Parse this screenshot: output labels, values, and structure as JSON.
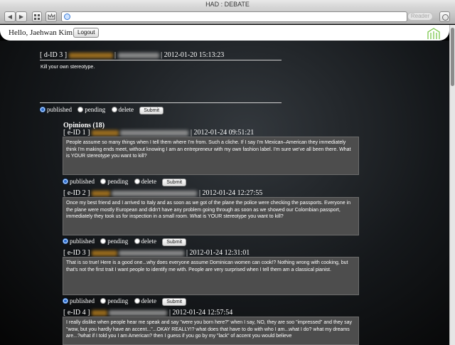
{
  "window": {
    "title": "HAD : DEBATE"
  },
  "toolbar": {
    "back_label": "◀",
    "forward_label": "▶",
    "reader_label": "Reader"
  },
  "header": {
    "greeting": "Hello, Jaehwan Kim. |",
    "logout_label": "Logout"
  },
  "debate": {
    "id_label": "[ d-ID 3 ]",
    "sep": "|",
    "timestamp": "| 2012-01-20 15:13:23",
    "text": "Kill your own stereotype.",
    "status": {
      "published": "published",
      "pending": "pending",
      "delete": "delete",
      "selected": "published"
    },
    "submit_label": "Submit"
  },
  "opinions_heading": "Opinions (18)",
  "opinions": [
    {
      "id_label": "[ e-ID 1 ]",
      "timestamp": "| 2012-01-24 09:51:21",
      "text": "People assume so many things when I tell them where I'm from. Such a cliche. If I say I'm Mexican–American they immediately think I'm making ends meet, without knowing I am an entrepreneur with my own fashion label. I'm sure we've all been there. What is YOUR stereotype you want to kill?",
      "published": "published",
      "pending": "pending",
      "delete": "delete",
      "submit": "Submit"
    },
    {
      "id_label": "[ e-ID 2 ]",
      "timestamp": "| 2012-01-24 12:27:55",
      "text": "Once my best friend and I arrived to Italy and as soon as we got of the plane the police were checking the passports. Everyone in the plane were mostly European and didn't have any problem going through as soon as we showed our Colombian passport, immediately they took us for inspection in a small room. What is YOUR stereotype you want to kill?",
      "published": "published",
      "pending": "pending",
      "delete": "delete",
      "submit": "Submit"
    },
    {
      "id_label": "[ e-ID 3 ]",
      "timestamp": "| 2012-01-24 12:31:01",
      "text": "That is so true! Here is a good one...why does everyone assume Dominican women can cook!? Nothing wrong with cooking, but that's not the first trait I want people to identify me with. People are very surprised when I tell them am a classical pianist.",
      "published": "published",
      "pending": "pending",
      "delete": "delete",
      "submit": "Submit"
    },
    {
      "id_label": "[ e-ID 4 ]",
      "timestamp": "| 2012-01-24 12:57:54",
      "text": "I really dislike when people hear me speak and say \"were you born here?\" when I say, NO, they are soo \"impressed\" and they say \"wow, but you hardly have an accent...\"...OKAY REALLY!? what does that have to do with who I am...what I do? what my dreams are...?what if I told you I am American? then I guess if you go by my \"lack\" of accent you would believe"
    }
  ]
}
